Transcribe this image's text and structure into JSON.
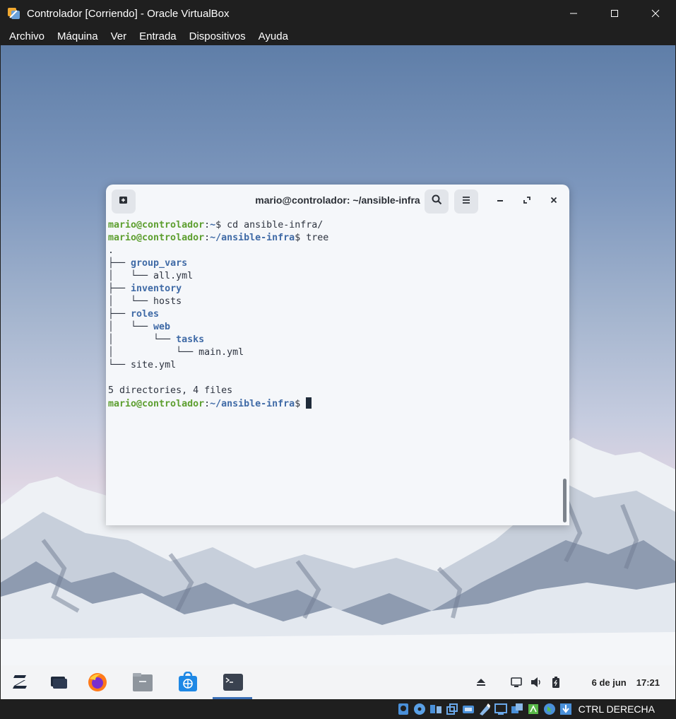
{
  "window": {
    "title": "Controlador [Corriendo] - Oracle VirtualBox",
    "app_icon": "virtualbox-icon",
    "controls": [
      "minimize-icon",
      "maximize-icon",
      "close-icon"
    ]
  },
  "menubar": {
    "items": [
      "Archivo",
      "Máquina",
      "Ver",
      "Entrada",
      "Dispositivos",
      "Ayuda"
    ]
  },
  "terminal": {
    "title": "mario@controlador: ~/ansible-infra",
    "prompt_user": "mario@controlador",
    "lines": [
      {
        "type": "prompt",
        "path": "~",
        "command": " cd ansible-infra/"
      },
      {
        "type": "prompt",
        "path": "~/ansible-infra",
        "command": " tree"
      },
      {
        "type": "tree",
        "prefix": ".",
        "name": "",
        "kind": "file"
      },
      {
        "type": "tree",
        "prefix": "├── ",
        "name": "group_vars",
        "kind": "dir"
      },
      {
        "type": "tree",
        "prefix": "│   └── ",
        "name": "all.yml",
        "kind": "file"
      },
      {
        "type": "tree",
        "prefix": "├── ",
        "name": "inventory",
        "kind": "dir"
      },
      {
        "type": "tree",
        "prefix": "│   └── ",
        "name": "hosts",
        "kind": "file"
      },
      {
        "type": "tree",
        "prefix": "├── ",
        "name": "roles",
        "kind": "dir"
      },
      {
        "type": "tree",
        "prefix": "│   └── ",
        "name": "web",
        "kind": "dir"
      },
      {
        "type": "tree",
        "prefix": "│       └── ",
        "name": "tasks",
        "kind": "dir"
      },
      {
        "type": "tree",
        "prefix": "│           └── ",
        "name": "main.yml",
        "kind": "file"
      },
      {
        "type": "tree",
        "prefix": "└── ",
        "name": "site.yml",
        "kind": "file"
      },
      {
        "type": "blank"
      },
      {
        "type": "text",
        "text": "5 directories, 4 files"
      },
      {
        "type": "prompt",
        "path": "~/ansible-infra",
        "command": " ",
        "cursor": true
      }
    ],
    "buttons": [
      "new-tab-icon",
      "search-icon",
      "hamburger-menu-icon",
      "minimize-icon",
      "maximize-icon",
      "close-icon"
    ]
  },
  "taskbar": {
    "apps": [
      "zorin-menu-icon",
      "workspaces-icon",
      "firefox-icon",
      "files-icon",
      "software-store-icon",
      "terminal-icon"
    ],
    "tray": [
      "eject-icon",
      "display-icon",
      "volume-icon",
      "battery-icon"
    ],
    "date": "6 de jun",
    "time": "17:21"
  },
  "statusbar": {
    "icons": [
      "hard-disk-icon",
      "optical-drive-icon",
      "audio-icon",
      "network-icon",
      "usb-icon",
      "shared-folders-icon",
      "display-icon",
      "video-capture-icon",
      "cpu-icon",
      "mouse-integration-icon",
      "host-key-arrow-icon"
    ],
    "host_key": "CTRL DERECHA"
  }
}
